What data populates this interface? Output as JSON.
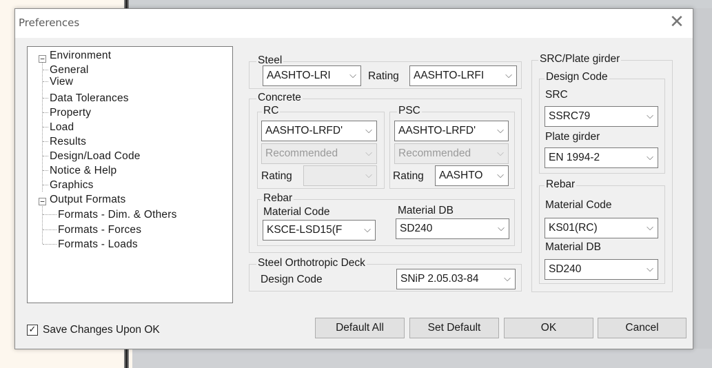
{
  "dialog": {
    "title": "Preferences",
    "close_glyph": "✕"
  },
  "tree": {
    "environment": {
      "label": "Environment",
      "toggle": "−",
      "children": [
        "General",
        "View",
        "Data Tolerances",
        "Property",
        "Load",
        "Results",
        "Design/Load Code",
        "Notice & Help",
        "Graphics"
      ]
    },
    "output": {
      "label": "Output Formats",
      "toggle": "−",
      "children": [
        "Formats - Dim. & Others",
        "Formats - Forces",
        "Formats - Loads"
      ]
    }
  },
  "steel": {
    "legend": "Steel",
    "code": "AASHTO-LRI",
    "rating_label": "Rating",
    "rating": "AASHTO-LRFI"
  },
  "concrete": {
    "legend": "Concrete",
    "rc": {
      "legend": "RC",
      "code": "AASHTO-LRFD'",
      "option": "Recommended",
      "rating_label": "Rating",
      "rating": ""
    },
    "psc": {
      "legend": "PSC",
      "code": "AASHTO-LRFD'",
      "option": "Recommended",
      "rating_label": "Rating",
      "rating": "AASHTO"
    },
    "rebar": {
      "legend": "Rebar",
      "material_code_label": "Material Code",
      "material_code": "KSCE-LSD15(F",
      "material_db_label": "Material DB",
      "material_db": "SD240"
    }
  },
  "orthotropic": {
    "legend": "Steel Orthotropic Deck",
    "design_code_label": "Design Code",
    "design_code": "SNiP 2.05.03-84"
  },
  "src": {
    "legend": "SRC/Plate girder",
    "design_code": {
      "legend": "Design Code",
      "src_label": "SRC",
      "src": "SSRC79",
      "plate_label": "Plate girder",
      "plate": "EN 1994-2"
    },
    "rebar": {
      "legend": "Rebar",
      "material_code_label": "Material Code",
      "material_code": "KS01(RC)",
      "material_db_label": "Material DB",
      "material_db": "SD240"
    }
  },
  "footer": {
    "save_checked": "✓",
    "save_label": "Save Changes Upon OK",
    "default_all": "Default All",
    "set_default": "Set Default",
    "ok": "OK",
    "cancel": "Cancel"
  },
  "icons": {
    "dropdown": "⌵"
  }
}
